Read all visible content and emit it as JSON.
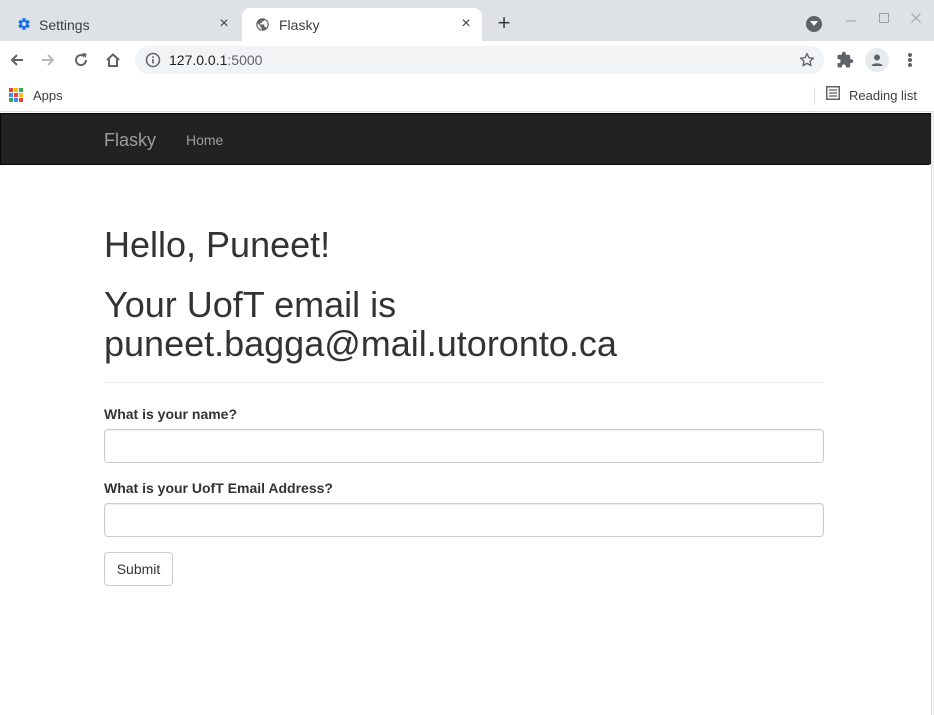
{
  "browser": {
    "tabs": [
      {
        "title": "Settings",
        "icon": "gear-icon",
        "active": false
      },
      {
        "title": "Flasky",
        "icon": "globe-icon",
        "active": true
      }
    ],
    "tab_close_glyph": "×",
    "new_tab_glyph": "+",
    "url_host": "127.0.0.1",
    "url_port": ":5000",
    "bookmarks": {
      "apps_label": "Apps",
      "reading_list_label": "Reading list"
    },
    "accent_color": "#1a73e8"
  },
  "navbar": {
    "brand": "Flasky",
    "links": [
      {
        "label": "Home"
      }
    ]
  },
  "main": {
    "greeting": "Hello, Puneet!",
    "email_message": "Your UofT email is puneet.bagga@mail.utoronto.ca"
  },
  "form": {
    "name_label": "What is your name?",
    "name_value": "",
    "email_label": "What is your UofT Email Address?",
    "email_value": "",
    "submit_label": "Submit"
  }
}
